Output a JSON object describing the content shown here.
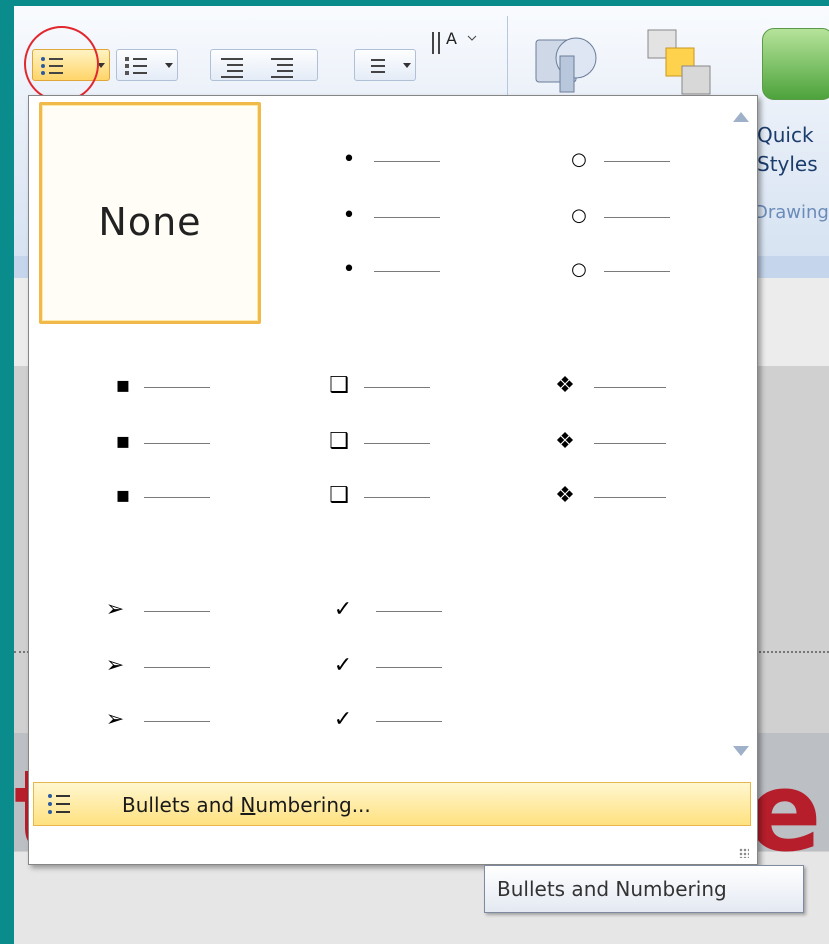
{
  "ribbon": {
    "quick_styles_label_1": "Quick",
    "quick_styles_label_2": "Styles",
    "group_label": "Drawing"
  },
  "gallery": {
    "none_label": "None",
    "items": [
      {
        "id": "none",
        "symbol": ""
      },
      {
        "id": "filled-round",
        "symbol": "•"
      },
      {
        "id": "hollow-round",
        "symbol": "○"
      },
      {
        "id": "filled-square",
        "symbol": "▪"
      },
      {
        "id": "hollow-square",
        "symbol": "❑"
      },
      {
        "id": "star-diamond",
        "symbol": "❖"
      },
      {
        "id": "arrow",
        "symbol": "➢"
      },
      {
        "id": "checkmark",
        "symbol": "✓"
      }
    ]
  },
  "menu": {
    "bullets_prefix": "Bullets and ",
    "bullets_underline": "N",
    "bullets_suffix": "umbering..."
  },
  "tooltip": {
    "text": "Bullets and Numbering"
  },
  "slide": {
    "letter_left": "t",
    "letter_right": "e"
  },
  "colors": {
    "selection_border": "#f0b94a",
    "highlight": "#ffe180",
    "title_red": "#b51e2a",
    "annotation_ring": "#e0282e"
  }
}
